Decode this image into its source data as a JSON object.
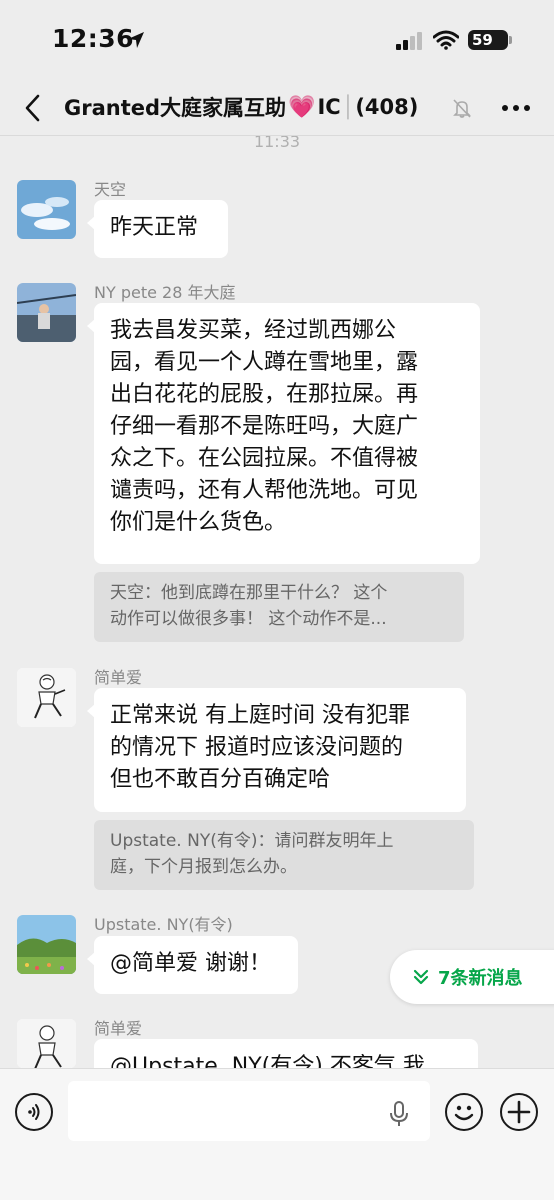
{
  "status": {
    "time": "12:36",
    "battery": "59"
  },
  "header": {
    "title_part1": "Granted大庭家属互助",
    "title_part2": "IC",
    "member_count": "(408)"
  },
  "timestamp": "11:33",
  "messages": [
    {
      "sender": "天空",
      "text": "昨天正常"
    },
    {
      "sender": "NY pete 28 年大庭",
      "lines": [
        "我去昌发买菜，经过凯西娜公",
        "园，看见一个人蹲在雪地里，露",
        "出白花花的屁股，在那拉屎。再",
        "仔细一看那不是陈旺吗，大庭广",
        "众之下。在公园拉屎。不值得被",
        "谴责吗，还有人帮他洗地。可见",
        "你们是什么货色。"
      ],
      "quote_lines": [
        "天空：他到底蹲在那里干什么？ 这个",
        "动作可以做很多事！ 这个动作不是..."
      ]
    },
    {
      "sender": "简单爱",
      "lines": [
        "正常来说 有上庭时间 没有犯罪",
        "的情况下 报道时应该没问题的",
        "但也不敢百分百确定哈"
      ],
      "quote_lines": [
        "Upstate. NY(有令)：请问群友明年上",
        "庭，下个月报到怎么办。"
      ]
    },
    {
      "sender": "Upstate. NY(有令)",
      "text": "@简单爱 谢谢！"
    },
    {
      "sender": "简单爱",
      "text": "@Upstate. NY(有令) 不客气 我"
    }
  ],
  "new_messages_label": "7条新消息",
  "colors": {
    "accent_green": "#07a64a",
    "heart": "#f04c9a"
  }
}
